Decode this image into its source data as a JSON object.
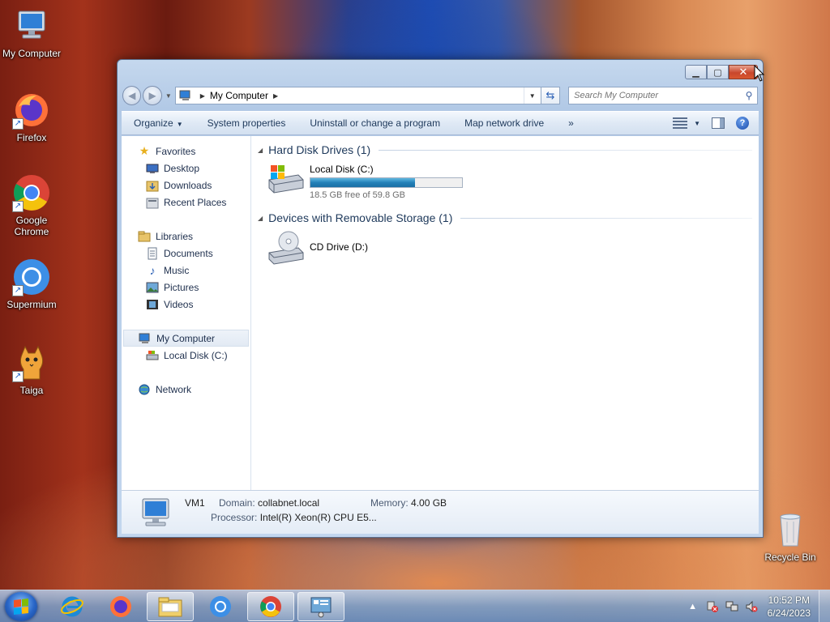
{
  "desktop": {
    "icons": [
      {
        "label": "My Computer"
      },
      {
        "label": "Firefox"
      },
      {
        "label": "Google Chrome"
      },
      {
        "label": "Supermium"
      },
      {
        "label": "Taiga"
      },
      {
        "label": "Recycle Bin"
      }
    ]
  },
  "window": {
    "address": {
      "crumb": "My Computer"
    },
    "search": {
      "placeholder": "Search My Computer"
    },
    "commands": {
      "organize": "Organize",
      "system_properties": "System properties",
      "uninstall": "Uninstall or change a program",
      "map_drive": "Map network drive",
      "more": "»"
    },
    "nav": {
      "favorites": "Favorites",
      "desktop": "Desktop",
      "downloads": "Downloads",
      "recent": "Recent Places",
      "libraries": "Libraries",
      "documents": "Documents",
      "music": "Music",
      "pictures": "Pictures",
      "videos": "Videos",
      "my_computer": "My Computer",
      "local_disk": "Local Disk (C:)",
      "network": "Network"
    },
    "groups": {
      "hdd": "Hard Disk Drives (1)",
      "removable": "Devices with Removable Storage (1)"
    },
    "drives": {
      "c": {
        "name": "Local Disk (C:)",
        "free_text": "18.5 GB free of 59.8 GB",
        "used_fraction": 0.69
      },
      "d": {
        "name": "CD Drive (D:)"
      }
    },
    "details": {
      "name": "VM1",
      "domain_label": "Domain:",
      "domain_value": "collabnet.local",
      "memory_label": "Memory:",
      "memory_value": "4.00 GB",
      "processor_label": "Processor:",
      "processor_value": "Intel(R) Xeon(R) CPU E5..."
    }
  },
  "taskbar": {
    "clock_time": "10:52 PM",
    "clock_date": "6/24/2023"
  }
}
